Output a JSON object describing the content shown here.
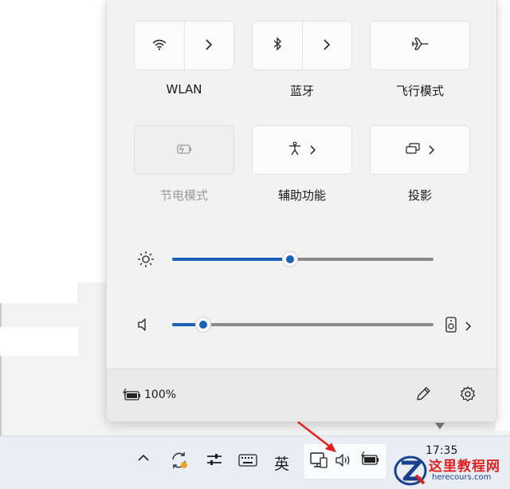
{
  "quick_settings": {
    "tiles": [
      {
        "id": "wlan",
        "label": "WLAN",
        "icon": "wifi-icon",
        "has_chevron": true,
        "state": "on"
      },
      {
        "id": "bluetooth",
        "label": "蓝牙",
        "icon": "bluetooth-icon",
        "has_chevron": true,
        "state": "on"
      },
      {
        "id": "airplane",
        "label": "飞行模式",
        "icon": "airplane-icon",
        "has_chevron": false,
        "state": "off"
      },
      {
        "id": "battery_saver",
        "label": "节电模式",
        "icon": "battery-saver-icon",
        "has_chevron": false,
        "state": "disabled"
      },
      {
        "id": "accessibility",
        "label": "辅助功能",
        "icon": "accessibility-icon",
        "has_chevron": true,
        "state": "off"
      },
      {
        "id": "project",
        "label": "投影",
        "icon": "project-icon",
        "has_chevron": true,
        "state": "off"
      }
    ],
    "brightness": {
      "icon": "brightness-icon",
      "value": 0.45
    },
    "volume": {
      "icon": "speaker-icon",
      "value": 0.12,
      "output_icon": "audio-output-icon"
    },
    "footer": {
      "battery_percent": "100%",
      "battery_icon": "battery-charging-icon",
      "edit_icon": "pencil-icon",
      "settings_icon": "gear-icon"
    },
    "colors": {
      "accent": "#1a62b8",
      "tile_bg": "#fbfbfb",
      "panel_bg": "#f2f2f2"
    }
  },
  "taskbar": {
    "ime_label": "英",
    "time": "17:35",
    "icons": [
      "chevron-up-icon",
      "sync-icon",
      "sliders-icon",
      "keyboard-icon",
      "network-icon",
      "speaker-icon",
      "battery-icon"
    ]
  },
  "watermark": {
    "title": "这里教程网",
    "url": "herecours.com"
  }
}
